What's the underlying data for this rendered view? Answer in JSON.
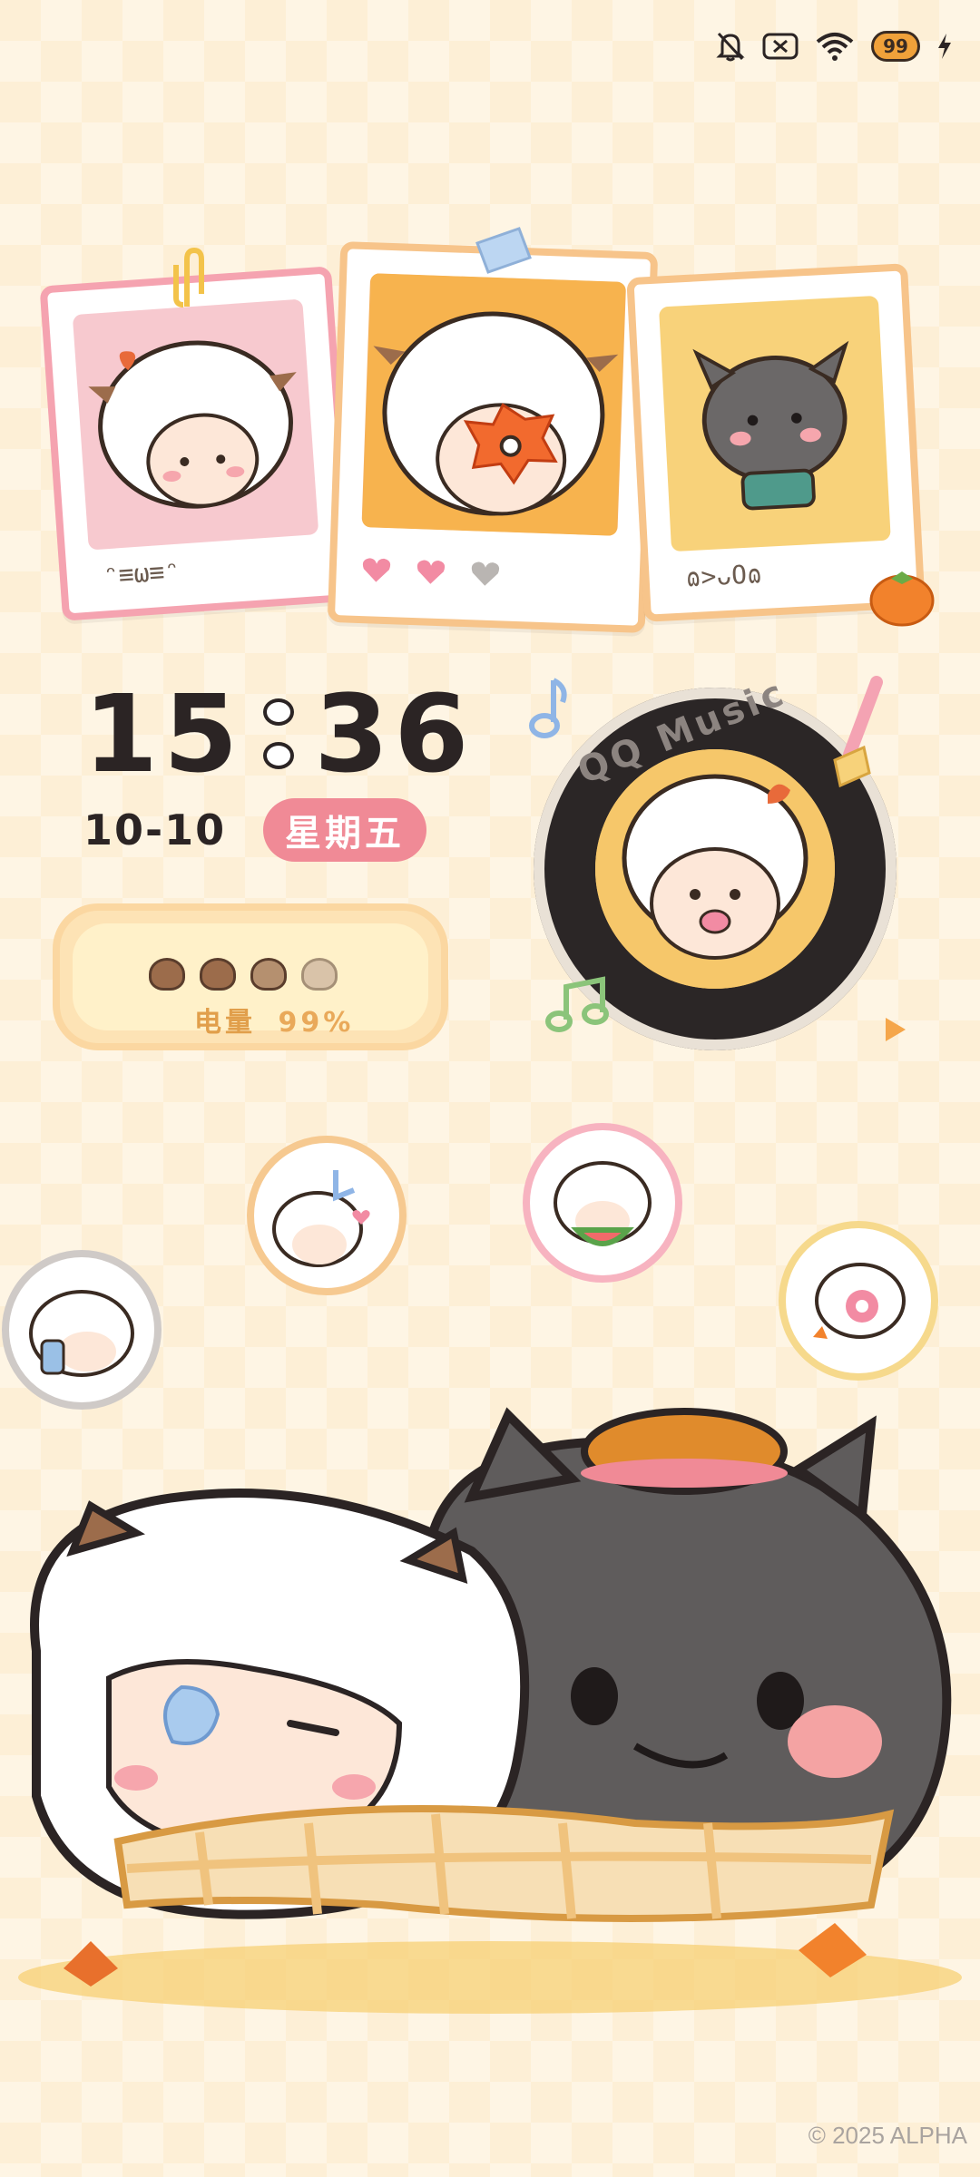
{
  "status_bar": {
    "icons": [
      "bell-muted-icon",
      "sim-none-icon",
      "wifi-icon",
      "battery-icon",
      "charging-icon"
    ],
    "battery_level": "99"
  },
  "polaroids": [
    {
      "caption": "ᵔ≡ω≡ᵔ",
      "frame_color": "#f5a3b0"
    },
    {
      "caption": "",
      "frame_color": "#f7c48a"
    },
    {
      "caption": "ɷ>ᴗOɷ",
      "frame_color": "#f7c48a"
    }
  ],
  "clock": {
    "hours": "15",
    "minutes": "36"
  },
  "date": {
    "day": "10-10",
    "weekday": "星期五"
  },
  "battery_widget": {
    "label": "电量",
    "percent": "99%"
  },
  "music": {
    "label": "QQ Music"
  },
  "footer": {
    "copyright": "© 2025 ALPHA"
  },
  "colors": {
    "accent_pink": "#f08a96",
    "accent_orange": "#f0a13a",
    "bg": "#fdefd6"
  }
}
